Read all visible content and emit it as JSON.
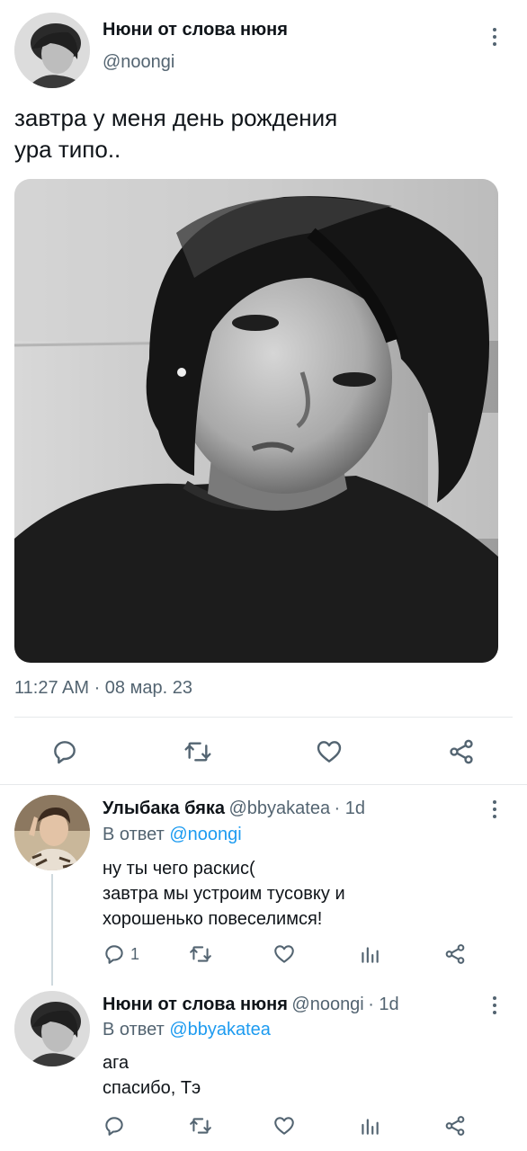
{
  "main_tweet": {
    "author_name": "Нюни от слова нюня",
    "author_handle": "@noongi",
    "text_line1": "завтра у меня день рождения",
    "text_line2": "ура типо..",
    "timestamp": "11:27 AM · 08 мар. 23",
    "icons": [
      "reply-icon",
      "retweet-icon",
      "like-icon",
      "share-icon"
    ]
  },
  "replies": [
    {
      "author_name": "Улыбака бяка",
      "author_handle": "@bbyakatea",
      "time": "· 1d",
      "reply_to_prefix": "В ответ",
      "reply_to_handle": "@noongi",
      "text": "ну ты чего раскис(\nзавтра мы устроим тусовку и\nхорошенько повеселимся!",
      "reply_count": "1"
    },
    {
      "author_name": "Нюни от слова нюня",
      "author_handle": "@noongi",
      "time": "· 1d",
      "reply_to_prefix": "В ответ",
      "reply_to_handle": "@bbyakatea",
      "text": "ага\nспасибо, Тэ",
      "reply_count": ""
    }
  ],
  "colors": {
    "accent": "#1d9bf0",
    "text": "#0f1419",
    "muted": "#536471"
  }
}
